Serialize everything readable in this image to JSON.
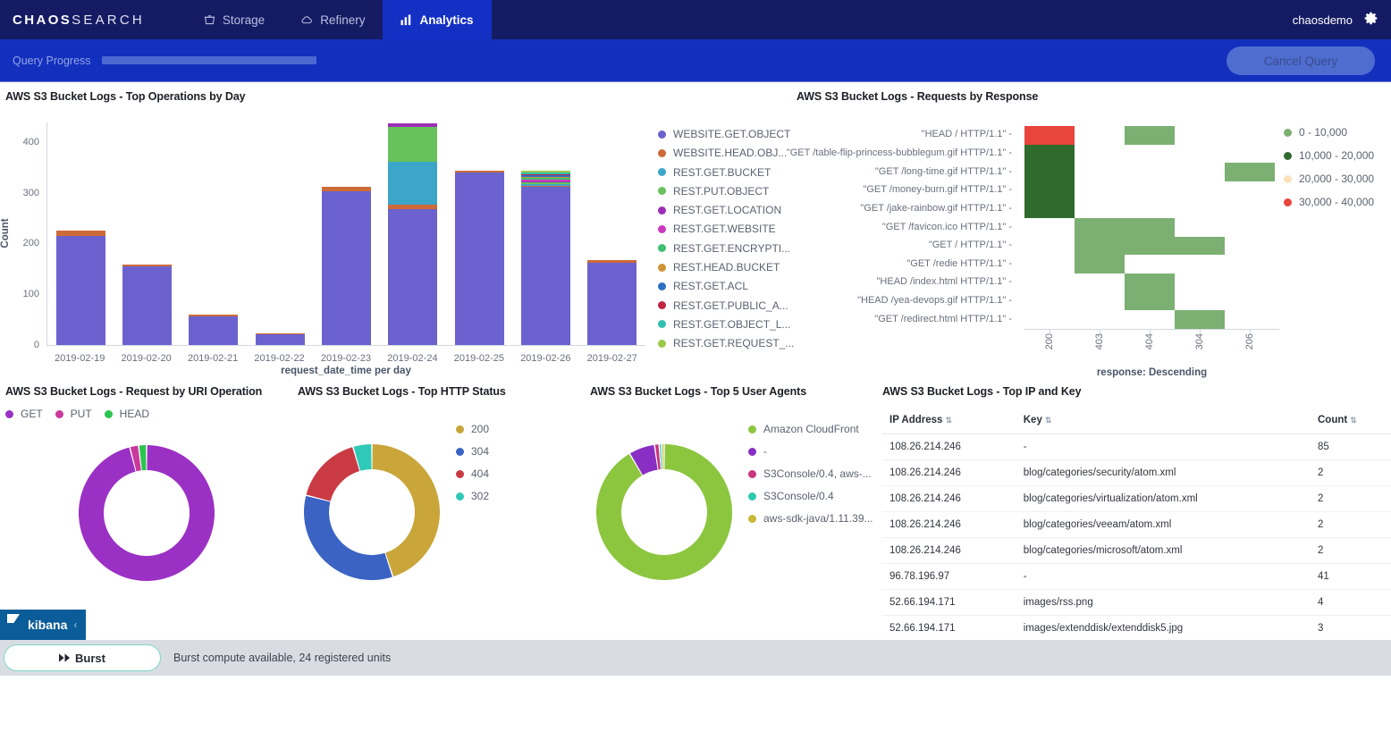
{
  "header": {
    "logo_bold": "CHAOS",
    "logo_light": "SEARCH",
    "nav": [
      {
        "label": "Storage",
        "icon": "storage-icon",
        "active": false
      },
      {
        "label": "Refinery",
        "icon": "cloud-icon",
        "active": false
      },
      {
        "label": "Analytics",
        "icon": "bar-chart-icon",
        "active": true
      }
    ],
    "user": "chaosdemo",
    "gear_icon": "gear-icon"
  },
  "query_bar": {
    "progress_label": "Query Progress",
    "progress_percent": 100,
    "cancel_label": "Cancel Query"
  },
  "panels": {
    "top_operations": {
      "title": "AWS S3 Bucket Logs - Top Operations by Day"
    },
    "requests_by_response": {
      "title": "AWS S3 Bucket Logs - Requests by Response"
    },
    "uri_operation": {
      "title": "AWS S3 Bucket Logs - Request by URI Operation"
    },
    "http_status": {
      "title": "AWS S3 Bucket Logs - Top HTTP Status"
    },
    "user_agents": {
      "title": "AWS S3 Bucket Logs - Top 5 User Agents"
    },
    "top_ip_key": {
      "title": "AWS S3 Bucket Logs - Top IP and Key"
    }
  },
  "chart_data": [
    {
      "id": "top_operations",
      "type": "bar",
      "stacked": true,
      "title": "AWS S3 Bucket Logs - Top Operations by Day",
      "xlabel": "request_date_time per day",
      "ylabel": "Count",
      "ylim": [
        0,
        440
      ],
      "yticks": [
        0,
        100,
        200,
        300,
        400
      ],
      "categories": [
        "2019-02-19",
        "2019-02-20",
        "2019-02-21",
        "2019-02-22",
        "2019-02-23",
        "2019-02-24",
        "2019-02-25",
        "2019-02-26",
        "2019-02-27"
      ],
      "legend_position": "right",
      "series": [
        {
          "name": "WEBSITE.GET.OBJECT",
          "color": "#6b62cf",
          "values": [
            215,
            155,
            57,
            21,
            302,
            268,
            339,
            311,
            162
          ]
        },
        {
          "name": "WEBSITE.HEAD.OBJ...",
          "color": "#cd6a37",
          "values": [
            10,
            3,
            1,
            1,
            10,
            8,
            4,
            3,
            5
          ]
        },
        {
          "name": "REST.GET.BUCKET",
          "color": "#3ca6c9",
          "values": [
            0,
            0,
            0,
            0,
            0,
            84,
            0,
            2,
            0
          ]
        },
        {
          "name": "REST.PUT.OBJECT",
          "color": "#67c15c",
          "values": [
            0,
            0,
            0,
            0,
            0,
            70,
            0,
            3,
            0
          ]
        },
        {
          "name": "REST.GET.LOCATION",
          "color": "#9b2fb5",
          "values": [
            0,
            0,
            0,
            0,
            0,
            6,
            0,
            3,
            0
          ]
        },
        {
          "name": "REST.GET.WEBSITE",
          "color": "#cc38c0",
          "values": [
            0,
            0,
            0,
            0,
            0,
            0,
            0,
            3,
            0
          ]
        },
        {
          "name": "REST.GET.ENCRYPTI...",
          "color": "#3fbf6f",
          "values": [
            0,
            0,
            0,
            0,
            0,
            0,
            0,
            3,
            0
          ]
        },
        {
          "name": "REST.HEAD.BUCKET",
          "color": "#ce9333",
          "values": [
            0,
            0,
            0,
            0,
            0,
            0,
            0,
            3,
            0
          ]
        },
        {
          "name": "REST.GET.ACL",
          "color": "#2b6fc4",
          "values": [
            0,
            0,
            0,
            0,
            0,
            0,
            0,
            2,
            0
          ]
        },
        {
          "name": "REST.GET.PUBLIC_A...",
          "color": "#bf2542",
          "values": [
            0,
            0,
            0,
            0,
            0,
            0,
            0,
            2,
            0
          ]
        },
        {
          "name": "REST.GET.OBJECT_L...",
          "color": "#2fc0ae",
          "values": [
            0,
            0,
            0,
            0,
            0,
            0,
            0,
            2,
            0
          ]
        },
        {
          "name": "REST.GET.REQUEST_...",
          "color": "#9cca4b",
          "values": [
            0,
            0,
            0,
            0,
            0,
            0,
            0,
            3,
            0
          ]
        }
      ]
    },
    {
      "id": "requests_by_response",
      "type": "heatmap",
      "title": "AWS S3 Bucket Logs - Requests by Response",
      "xlabel": "response: Descending",
      "ylabel": "",
      "x_categories": [
        "200",
        "403",
        "404",
        "304",
        "206"
      ],
      "y_categories": [
        "\"HEAD / HTTP/1.1\"",
        "\"GET /table-flip-princess-bubblegum.gif HTTP/1.1\"",
        "\"GET /long-time.gif HTTP/1.1\"",
        "\"GET /money-burn.gif HTTP/1.1\"",
        "\"GET /jake-rainbow.gif HTTP/1.1\"",
        "\"GET /favicon.ico HTTP/1.1\"",
        "\"GET / HTTP/1.1\"",
        "\"GET /redie HTTP/1.1\"",
        "\"HEAD /index.html HTTP/1.1\"",
        "\"HEAD /yea-devops.gif HTTP/1.1\"",
        "\"GET /redirect.html HTTP/1.1\""
      ],
      "legend_position": "right",
      "legend": [
        {
          "label": "0 - 10,000",
          "color": "#7cb072"
        },
        {
          "label": "10,000 - 20,000",
          "color": "#2f6b2d"
        },
        {
          "label": "20,000 - 30,000",
          "color": "#fbe2bc"
        },
        {
          "label": "30,000 - 40,000",
          "color": "#e8453c"
        }
      ],
      "cells": [
        {
          "x": "200",
          "y": "\"HEAD / HTTP/1.1\"",
          "bucket": "30,000 - 40,000"
        },
        {
          "x": "404",
          "y": "\"HEAD / HTTP/1.1\"",
          "bucket": "0 - 10,000"
        },
        {
          "x": "200",
          "y": "\"GET /table-flip-princess-bubblegum.gif HTTP/1.1\"",
          "bucket": "10,000 - 20,000"
        },
        {
          "x": "200",
          "y": "\"GET /long-time.gif HTTP/1.1\"",
          "bucket": "10,000 - 20,000"
        },
        {
          "x": "206",
          "y": "\"GET /long-time.gif HTTP/1.1\"",
          "bucket": "0 - 10,000"
        },
        {
          "x": "200",
          "y": "\"GET /money-burn.gif HTTP/1.1\"",
          "bucket": "10,000 - 20,000"
        },
        {
          "x": "200",
          "y": "\"GET /jake-rainbow.gif HTTP/1.1\"",
          "bucket": "10,000 - 20,000"
        },
        {
          "x": "403",
          "y": "\"GET /favicon.ico HTTP/1.1\"",
          "bucket": "0 - 10,000"
        },
        {
          "x": "404",
          "y": "\"GET /favicon.ico HTTP/1.1\"",
          "bucket": "0 - 10,000"
        },
        {
          "x": "403",
          "y": "\"GET / HTTP/1.1\"",
          "bucket": "0 - 10,000"
        },
        {
          "x": "404",
          "y": "\"GET / HTTP/1.1\"",
          "bucket": "0 - 10,000"
        },
        {
          "x": "304",
          "y": "\"GET / HTTP/1.1\"",
          "bucket": "0 - 10,000"
        },
        {
          "x": "403",
          "y": "\"GET /redie HTTP/1.1\"",
          "bucket": "0 - 10,000"
        },
        {
          "x": "404",
          "y": "\"HEAD /index.html HTTP/1.1\"",
          "bucket": "0 - 10,000"
        },
        {
          "x": "404",
          "y": "\"HEAD /yea-devops.gif HTTP/1.1\"",
          "bucket": "0 - 10,000"
        },
        {
          "x": "304",
          "y": "\"GET /redirect.html HTTP/1.1\"",
          "bucket": "0 - 10,000"
        }
      ]
    },
    {
      "id": "uri_operation",
      "type": "pie",
      "donut": true,
      "title": "AWS S3 Bucket Logs - Request by URI Operation",
      "legend_position": "top",
      "labels": [
        "GET",
        "PUT",
        "HEAD"
      ],
      "colors": [
        "#9b30c4",
        "#c9399c",
        "#2bc44f"
      ],
      "values": [
        96.0,
        2.1,
        1.9
      ]
    },
    {
      "id": "http_status",
      "type": "pie",
      "donut": true,
      "title": "AWS S3 Bucket Logs - Top HTTP Status",
      "legend_position": "right",
      "labels": [
        "200",
        "304",
        "404",
        "302"
      ],
      "colors": [
        "#c9a53a",
        "#3a63c4",
        "#c93a42",
        "#2fc9b8"
      ],
      "values": [
        45.0,
        34.0,
        16.5,
        4.5
      ]
    },
    {
      "id": "user_agents",
      "type": "pie",
      "donut": true,
      "title": "AWS S3 Bucket Logs - Top 5 User Agents",
      "legend_position": "right",
      "labels": [
        "Amazon CloudFront",
        "-",
        "S3Console/0.4, aws-...",
        "S3Console/0.4",
        "aws-sdk-java/1.11.39..."
      ],
      "colors": [
        "#8cc63f",
        "#8a2fc4",
        "#c9357f",
        "#2fc9ae",
        "#c9b836"
      ],
      "values": [
        91.5,
        6.2,
        1.1,
        0.6,
        0.6
      ]
    },
    {
      "id": "top_ip_key",
      "type": "table",
      "title": "AWS S3 Bucket Logs - Top IP and Key",
      "columns": [
        "IP Address",
        "Key",
        "Count"
      ],
      "rows": [
        [
          "108.26.214.246",
          "-",
          "85"
        ],
        [
          "108.26.214.246",
          "blog/categories/security/atom.xml",
          "2"
        ],
        [
          "108.26.214.246",
          "blog/categories/virtualization/atom.xml",
          "2"
        ],
        [
          "108.26.214.246",
          "blog/categories/veeam/atom.xml",
          "2"
        ],
        [
          "108.26.214.246",
          "blog/categories/microsoft/atom.xml",
          "2"
        ],
        [
          "96.78.196.97",
          "-",
          "41"
        ],
        [
          "52.66.194.171",
          "images/rss.png",
          "4"
        ],
        [
          "52.66.194.171",
          "images/extenddisk/extenddisk5.jpg",
          "3"
        ]
      ]
    }
  ],
  "kibana_tab": {
    "label": "kibana",
    "chevron": "‹"
  },
  "footer": {
    "burst_label": "Burst",
    "burst_icon": "fast-forward-icon",
    "note": "Burst compute available, 24 registered units"
  }
}
